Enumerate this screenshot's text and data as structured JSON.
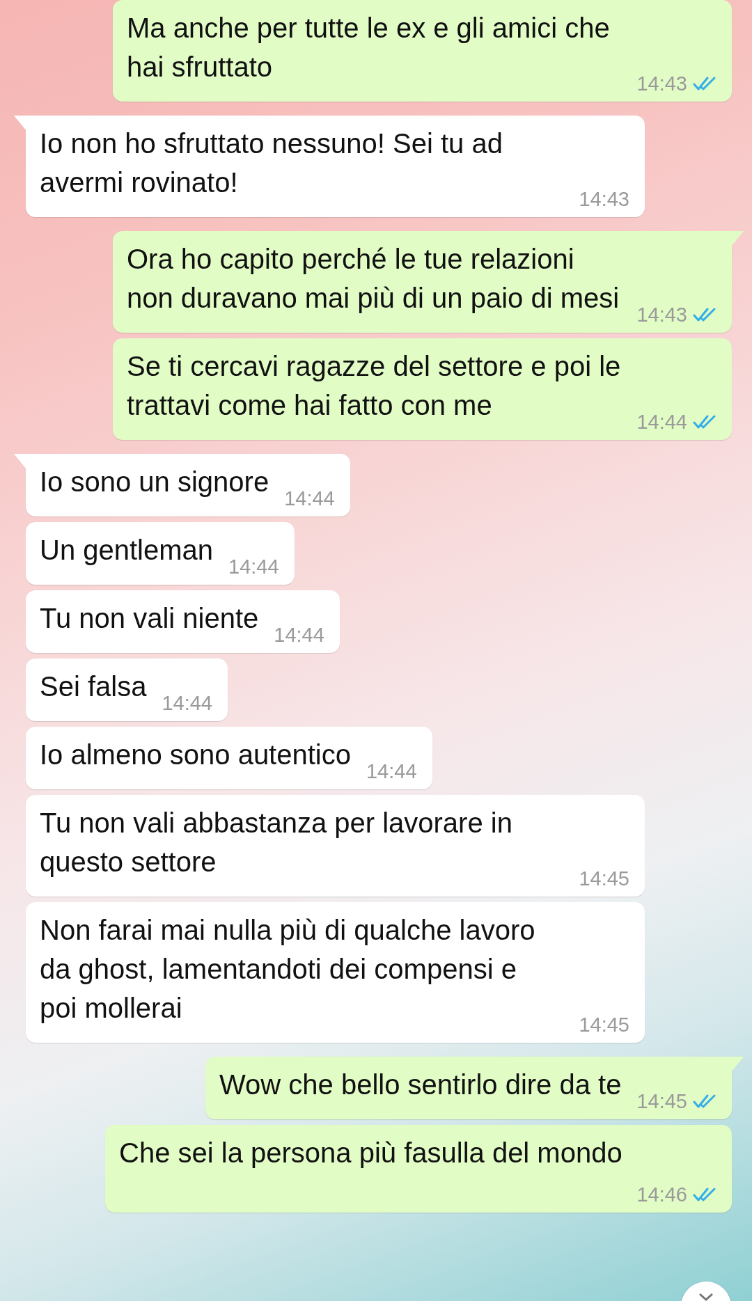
{
  "messages": [
    {
      "kind": "outgoing",
      "tail": false,
      "text": "Ma anche per tutte le ex e gli amici che\nhai sfruttato",
      "time": "14:43",
      "read": true
    },
    {
      "kind": "incoming",
      "tail": true,
      "text": "Io non ho sfruttato nessuno! Sei tu ad\navermi rovinato!",
      "time": "14:43"
    },
    {
      "kind": "outgoing",
      "tail": true,
      "text": "Ora ho capito perché le tue relazioni\nnon duravano mai più di un paio di mesi",
      "time": "14:43",
      "read": true
    },
    {
      "kind": "outgoing",
      "tail": false,
      "text": "Se ti cercavi ragazze del settore e poi le\ntrattavi come hai fatto con me",
      "time": "14:44",
      "read": true
    },
    {
      "kind": "incoming",
      "tail": true,
      "text": "Io sono un signore",
      "time": "14:44"
    },
    {
      "kind": "incoming",
      "tail": false,
      "text": "Un gentleman",
      "time": "14:44"
    },
    {
      "kind": "incoming",
      "tail": false,
      "text": "Tu non vali niente",
      "time": "14:44"
    },
    {
      "kind": "incoming",
      "tail": false,
      "text": "Sei falsa",
      "time": "14:44"
    },
    {
      "kind": "incoming",
      "tail": false,
      "text": "Io almeno sono autentico",
      "time": "14:44"
    },
    {
      "kind": "incoming",
      "tail": false,
      "text": "Tu non vali abbastanza per lavorare in\nquesto settore",
      "time": "14:45"
    },
    {
      "kind": "incoming",
      "tail": false,
      "text": "Non farai mai nulla più di qualche lavoro\nda ghost, lamentandoti dei compensi e\npoi mollerai",
      "time": "14:45"
    },
    {
      "kind": "outgoing",
      "tail": true,
      "text": "Wow che bello sentirlo dire da te",
      "time": "14:45",
      "read": true
    },
    {
      "kind": "outgoing",
      "tail": false,
      "text": "Che sei la persona più fasulla del mondo",
      "time": "14:46",
      "read": true
    }
  ],
  "scroll_to_bottom": true
}
